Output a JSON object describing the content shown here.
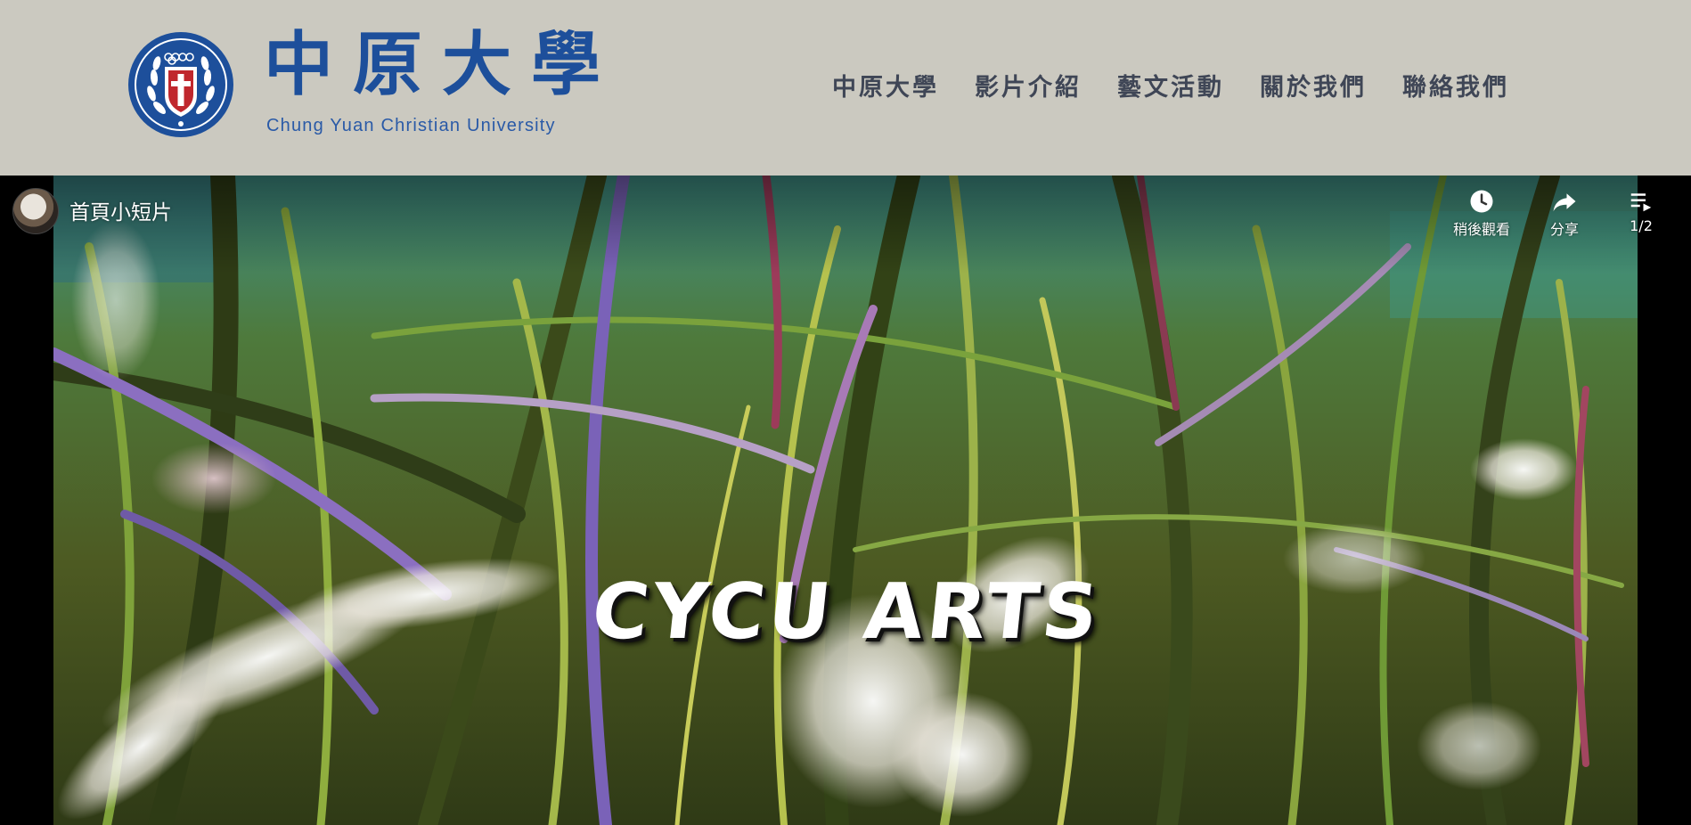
{
  "header": {
    "logo_cn": "中原大學",
    "logo_en": "Chung Yuan Christian University",
    "nav": [
      "中原大學",
      "影片介紹",
      "藝文活動",
      "關於我們",
      "聯絡我們"
    ]
  },
  "video": {
    "title": "首頁小短片",
    "overlay_text": "CYCU ARTS",
    "controls": {
      "watch_later": "稍後觀看",
      "share": "分享",
      "playlist": "1/2"
    }
  },
  "colors": {
    "header_bg": "#cbc9c0",
    "brand_blue": "#1d4f9b",
    "nav_text": "#3f4656"
  },
  "icons": [
    "university-emblem",
    "clock-icon",
    "share-icon",
    "playlist-icon"
  ]
}
